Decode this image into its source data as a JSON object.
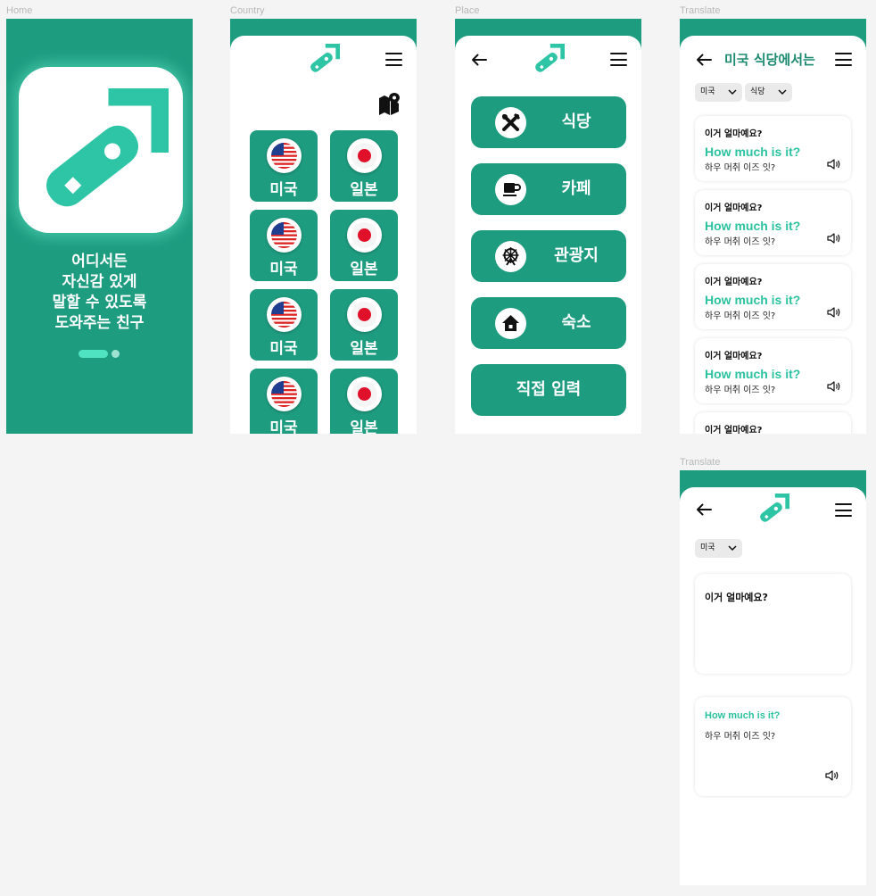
{
  "frames": {
    "home": {
      "label": "Home"
    },
    "country": {
      "label": "Country"
    },
    "place": {
      "label": "Place"
    },
    "translate_list": {
      "label": "Translate"
    },
    "translate_detail": {
      "label": "Translate"
    }
  },
  "colors": {
    "brand": "#1e9c80",
    "accent": "#2bc29f",
    "logo": "#2ec5a6"
  },
  "home": {
    "tagline": [
      "어디서든",
      "자신감 있게",
      "말할 수 있도록",
      "도와주는 친구"
    ],
    "pager": {
      "active_index": 0,
      "total": 2
    }
  },
  "country": {
    "map_icon": "map-pin-icon",
    "countries": [
      {
        "name": "미국",
        "flag": "us-flag-icon"
      },
      {
        "name": "일본",
        "flag": "jp-flag-icon"
      },
      {
        "name": "미국",
        "flag": "us-flag-icon"
      },
      {
        "name": "일본",
        "flag": "jp-flag-icon"
      },
      {
        "name": "미국",
        "flag": "us-flag-icon"
      },
      {
        "name": "일본",
        "flag": "jp-flag-icon"
      },
      {
        "name": "미국",
        "flag": "us-flag-icon"
      },
      {
        "name": "일본",
        "flag": "jp-flag-icon"
      }
    ]
  },
  "place": {
    "items": [
      {
        "label": "식당",
        "icon": "fork-knife-icon"
      },
      {
        "label": "카페",
        "icon": "coffee-cup-icon"
      },
      {
        "label": "관광지",
        "icon": "ferris-wheel-icon"
      },
      {
        "label": "숙소",
        "icon": "home-icon"
      }
    ],
    "manual_input": "직접 입력"
  },
  "translate_list": {
    "title": "미국 식당에서는",
    "filters": [
      "미국",
      "식당"
    ],
    "cards": [
      {
        "question": "이거 얼마예요?",
        "answer": "How much is it?",
        "pronunciation": "하우 머취 이즈 잇?"
      },
      {
        "question": "이거 얼마예요?",
        "answer": "How much is it?",
        "pronunciation": "하우 머취 이즈 잇?"
      },
      {
        "question": "이거 얼마예요?",
        "answer": "How much is it?",
        "pronunciation": "하우 머취 이즈 잇?"
      },
      {
        "question": "이거 얼마예요?",
        "answer": "How much is it?",
        "pronunciation": "하우 머취 이즈 잇?"
      },
      {
        "question": "이거 얼마예요?",
        "answer": "",
        "pronunciation": ""
      }
    ]
  },
  "translate_detail": {
    "filter": "미국",
    "input_text": "이거 얼마예요?",
    "answer": "How much is it?",
    "pronunciation": "하우 머취 이즈 잇?"
  }
}
